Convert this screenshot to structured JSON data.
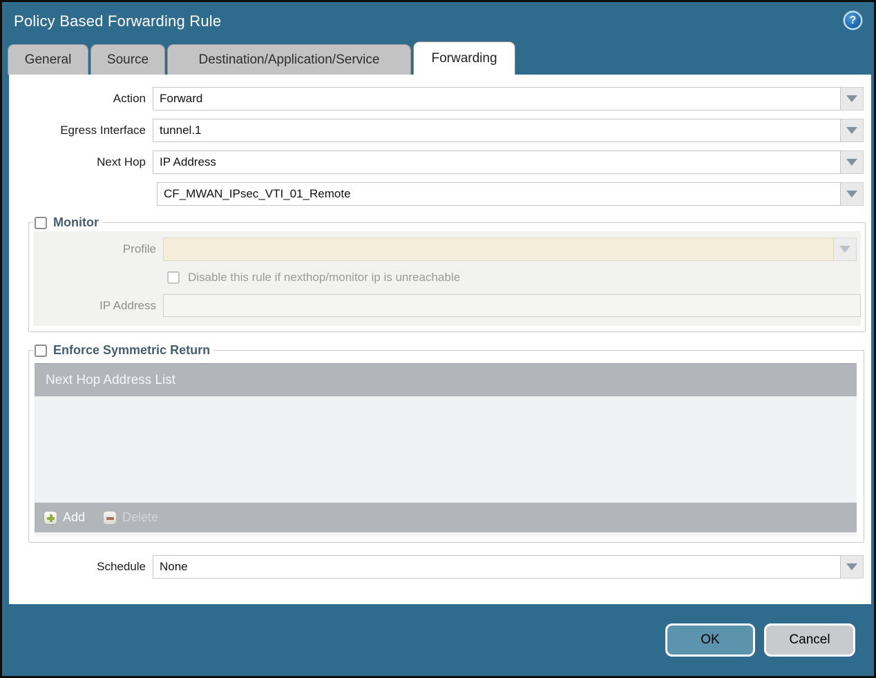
{
  "dialog": {
    "title": "Policy Based Forwarding Rule",
    "help_icon": "?"
  },
  "tabs": [
    {
      "label": "General",
      "active": false
    },
    {
      "label": "Source",
      "active": false
    },
    {
      "label": "Destination/Application/Service",
      "active": false
    },
    {
      "label": "Forwarding",
      "active": true
    }
  ],
  "form": {
    "action": {
      "label": "Action",
      "value": "Forward"
    },
    "egress_interface": {
      "label": "Egress Interface",
      "value": "tunnel.1"
    },
    "next_hop": {
      "label": "Next Hop",
      "value": "IP Address"
    },
    "next_hop_address": {
      "value": "CF_MWAN_IPsec_VTI_01_Remote"
    },
    "schedule": {
      "label": "Schedule",
      "value": "None"
    }
  },
  "monitor": {
    "legend": "Monitor",
    "checked": false,
    "profile": {
      "label": "Profile",
      "value": ""
    },
    "disable_rule": {
      "label": "Disable this rule if nexthop/monitor ip is unreachable",
      "checked": false
    },
    "ip_address": {
      "label": "IP Address",
      "value": ""
    }
  },
  "symmetric_return": {
    "legend": "Enforce Symmetric Return",
    "checked": false,
    "table": {
      "header": "Next Hop Address List",
      "rows": []
    },
    "add_label": "Add",
    "delete_label": "Delete",
    "delete_enabled": false
  },
  "footer": {
    "ok_label": "OK",
    "cancel_label": "Cancel"
  },
  "colors": {
    "titlebar_teal": "#2e6b8d",
    "active_tab": "#ffffff",
    "inactive_tab": "#c3c3c3",
    "fieldset_legend": "#44606e",
    "disabled_field_cream": "#f3edd9",
    "table_header_gray": "#b2b6ba",
    "ok_button": "#5c94ae",
    "cancel_button": "#c9cacd",
    "add_icon_green": "#8fae3e",
    "delete_icon_red": "#a9705f"
  }
}
